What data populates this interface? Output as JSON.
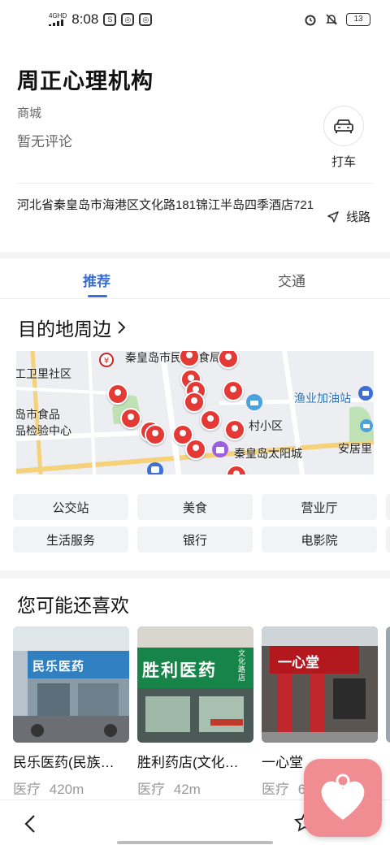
{
  "status_bar": {
    "network": "4GHD",
    "time": "8:08",
    "battery": "13"
  },
  "place": {
    "name": "周正心理机构",
    "category": "商城",
    "reviews": "暂无评论",
    "taxi_label": "打车",
    "address": "河北省秦皇岛市海港区文化路181锦江半岛四季酒店721",
    "route_label": "线路"
  },
  "tabs": [
    {
      "label": "推荐",
      "active": true
    },
    {
      "label": "交通",
      "active": false
    }
  ],
  "nearby": {
    "title": "目的地周边",
    "map_labels": [
      "秦皇岛市民",
      "食局",
      "工卫里社区",
      "渔业加油站",
      "岛市食品",
      "品检验中心",
      "村小区",
      "安居里",
      "秦皇岛太阳城"
    ],
    "chips": [
      "公交站",
      "美食",
      "营业厅",
      "生活服务",
      "银行",
      "电影院"
    ]
  },
  "recommend": {
    "title": "您可能还喜欢",
    "cards": [
      {
        "name": "民乐医药(民族…",
        "category": "医疗",
        "distance": "420m",
        "sign": "民乐医药"
      },
      {
        "name": "胜利药店(文化…",
        "category": "医疗",
        "distance": "42m",
        "sign": "胜利医药",
        "sign_side": "文化路店"
      },
      {
        "name": "一心堂",
        "category": "医疗",
        "distance": "6",
        "sign": "一心堂"
      }
    ]
  },
  "colors": {
    "accent": "#3b6fd8",
    "pin": "#e53935",
    "float_app": "#ef8d93"
  }
}
